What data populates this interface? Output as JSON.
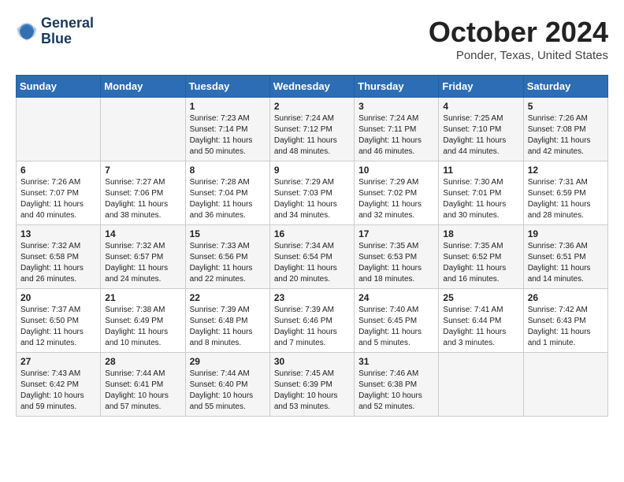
{
  "header": {
    "logo_line1": "General",
    "logo_line2": "Blue",
    "month_title": "October 2024",
    "location": "Ponder, Texas, United States"
  },
  "weekdays": [
    "Sunday",
    "Monday",
    "Tuesday",
    "Wednesday",
    "Thursday",
    "Friday",
    "Saturday"
  ],
  "weeks": [
    [
      {
        "day": "",
        "sunrise": "",
        "sunset": "",
        "daylight": ""
      },
      {
        "day": "",
        "sunrise": "",
        "sunset": "",
        "daylight": ""
      },
      {
        "day": "1",
        "sunrise": "Sunrise: 7:23 AM",
        "sunset": "Sunset: 7:14 PM",
        "daylight": "Daylight: 11 hours and 50 minutes."
      },
      {
        "day": "2",
        "sunrise": "Sunrise: 7:24 AM",
        "sunset": "Sunset: 7:12 PM",
        "daylight": "Daylight: 11 hours and 48 minutes."
      },
      {
        "day": "3",
        "sunrise": "Sunrise: 7:24 AM",
        "sunset": "Sunset: 7:11 PM",
        "daylight": "Daylight: 11 hours and 46 minutes."
      },
      {
        "day": "4",
        "sunrise": "Sunrise: 7:25 AM",
        "sunset": "Sunset: 7:10 PM",
        "daylight": "Daylight: 11 hours and 44 minutes."
      },
      {
        "day": "5",
        "sunrise": "Sunrise: 7:26 AM",
        "sunset": "Sunset: 7:08 PM",
        "daylight": "Daylight: 11 hours and 42 minutes."
      }
    ],
    [
      {
        "day": "6",
        "sunrise": "Sunrise: 7:26 AM",
        "sunset": "Sunset: 7:07 PM",
        "daylight": "Daylight: 11 hours and 40 minutes."
      },
      {
        "day": "7",
        "sunrise": "Sunrise: 7:27 AM",
        "sunset": "Sunset: 7:06 PM",
        "daylight": "Daylight: 11 hours and 38 minutes."
      },
      {
        "day": "8",
        "sunrise": "Sunrise: 7:28 AM",
        "sunset": "Sunset: 7:04 PM",
        "daylight": "Daylight: 11 hours and 36 minutes."
      },
      {
        "day": "9",
        "sunrise": "Sunrise: 7:29 AM",
        "sunset": "Sunset: 7:03 PM",
        "daylight": "Daylight: 11 hours and 34 minutes."
      },
      {
        "day": "10",
        "sunrise": "Sunrise: 7:29 AM",
        "sunset": "Sunset: 7:02 PM",
        "daylight": "Daylight: 11 hours and 32 minutes."
      },
      {
        "day": "11",
        "sunrise": "Sunrise: 7:30 AM",
        "sunset": "Sunset: 7:01 PM",
        "daylight": "Daylight: 11 hours and 30 minutes."
      },
      {
        "day": "12",
        "sunrise": "Sunrise: 7:31 AM",
        "sunset": "Sunset: 6:59 PM",
        "daylight": "Daylight: 11 hours and 28 minutes."
      }
    ],
    [
      {
        "day": "13",
        "sunrise": "Sunrise: 7:32 AM",
        "sunset": "Sunset: 6:58 PM",
        "daylight": "Daylight: 11 hours and 26 minutes."
      },
      {
        "day": "14",
        "sunrise": "Sunrise: 7:32 AM",
        "sunset": "Sunset: 6:57 PM",
        "daylight": "Daylight: 11 hours and 24 minutes."
      },
      {
        "day": "15",
        "sunrise": "Sunrise: 7:33 AM",
        "sunset": "Sunset: 6:56 PM",
        "daylight": "Daylight: 11 hours and 22 minutes."
      },
      {
        "day": "16",
        "sunrise": "Sunrise: 7:34 AM",
        "sunset": "Sunset: 6:54 PM",
        "daylight": "Daylight: 11 hours and 20 minutes."
      },
      {
        "day": "17",
        "sunrise": "Sunrise: 7:35 AM",
        "sunset": "Sunset: 6:53 PM",
        "daylight": "Daylight: 11 hours and 18 minutes."
      },
      {
        "day": "18",
        "sunrise": "Sunrise: 7:35 AM",
        "sunset": "Sunset: 6:52 PM",
        "daylight": "Daylight: 11 hours and 16 minutes."
      },
      {
        "day": "19",
        "sunrise": "Sunrise: 7:36 AM",
        "sunset": "Sunset: 6:51 PM",
        "daylight": "Daylight: 11 hours and 14 minutes."
      }
    ],
    [
      {
        "day": "20",
        "sunrise": "Sunrise: 7:37 AM",
        "sunset": "Sunset: 6:50 PM",
        "daylight": "Daylight: 11 hours and 12 minutes."
      },
      {
        "day": "21",
        "sunrise": "Sunrise: 7:38 AM",
        "sunset": "Sunset: 6:49 PM",
        "daylight": "Daylight: 11 hours and 10 minutes."
      },
      {
        "day": "22",
        "sunrise": "Sunrise: 7:39 AM",
        "sunset": "Sunset: 6:48 PM",
        "daylight": "Daylight: 11 hours and 8 minutes."
      },
      {
        "day": "23",
        "sunrise": "Sunrise: 7:39 AM",
        "sunset": "Sunset: 6:46 PM",
        "daylight": "Daylight: 11 hours and 7 minutes."
      },
      {
        "day": "24",
        "sunrise": "Sunrise: 7:40 AM",
        "sunset": "Sunset: 6:45 PM",
        "daylight": "Daylight: 11 hours and 5 minutes."
      },
      {
        "day": "25",
        "sunrise": "Sunrise: 7:41 AM",
        "sunset": "Sunset: 6:44 PM",
        "daylight": "Daylight: 11 hours and 3 minutes."
      },
      {
        "day": "26",
        "sunrise": "Sunrise: 7:42 AM",
        "sunset": "Sunset: 6:43 PM",
        "daylight": "Daylight: 11 hours and 1 minute."
      }
    ],
    [
      {
        "day": "27",
        "sunrise": "Sunrise: 7:43 AM",
        "sunset": "Sunset: 6:42 PM",
        "daylight": "Daylight: 10 hours and 59 minutes."
      },
      {
        "day": "28",
        "sunrise": "Sunrise: 7:44 AM",
        "sunset": "Sunset: 6:41 PM",
        "daylight": "Daylight: 10 hours and 57 minutes."
      },
      {
        "day": "29",
        "sunrise": "Sunrise: 7:44 AM",
        "sunset": "Sunset: 6:40 PM",
        "daylight": "Daylight: 10 hours and 55 minutes."
      },
      {
        "day": "30",
        "sunrise": "Sunrise: 7:45 AM",
        "sunset": "Sunset: 6:39 PM",
        "daylight": "Daylight: 10 hours and 53 minutes."
      },
      {
        "day": "31",
        "sunrise": "Sunrise: 7:46 AM",
        "sunset": "Sunset: 6:38 PM",
        "daylight": "Daylight: 10 hours and 52 minutes."
      },
      {
        "day": "",
        "sunrise": "",
        "sunset": "",
        "daylight": ""
      },
      {
        "day": "",
        "sunrise": "",
        "sunset": "",
        "daylight": ""
      }
    ]
  ]
}
